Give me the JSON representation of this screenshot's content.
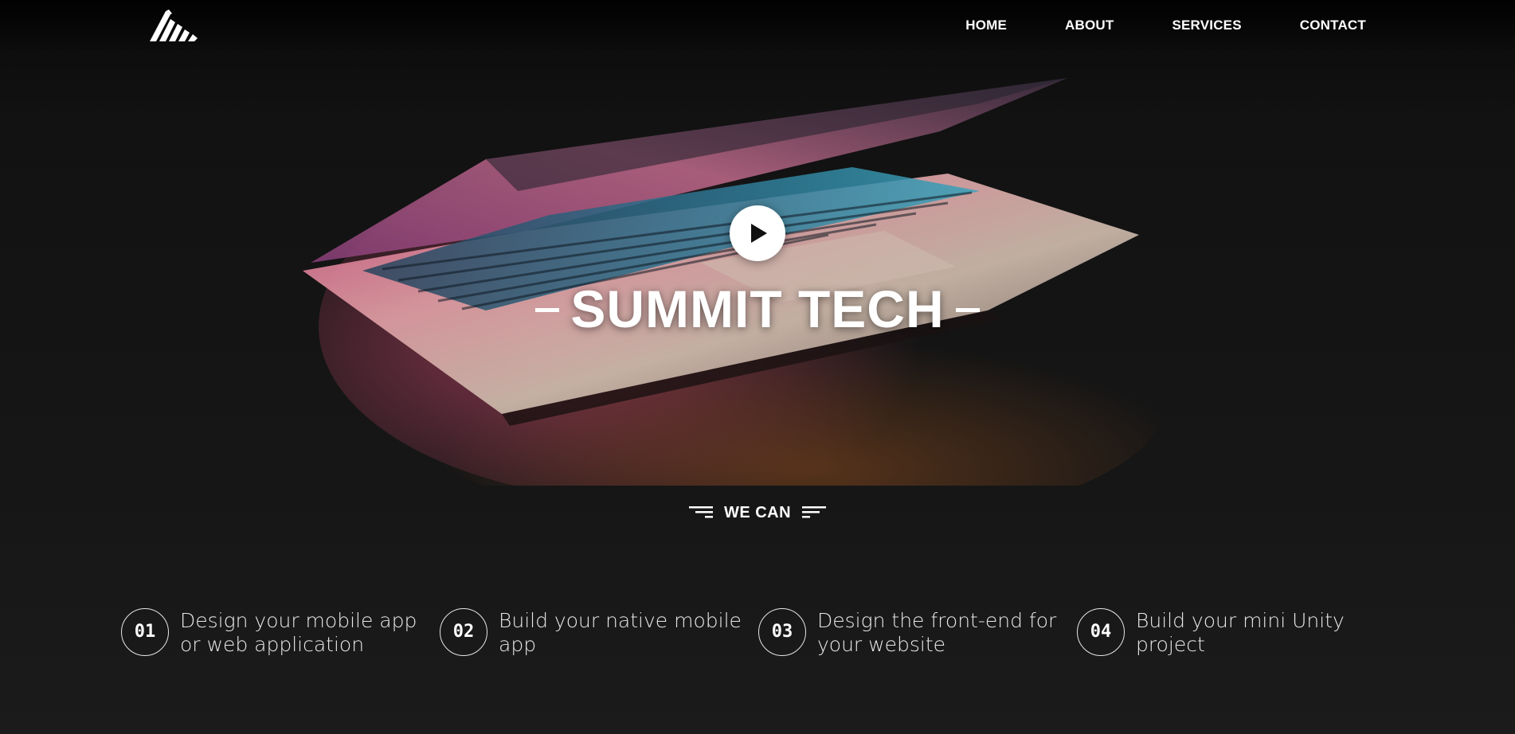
{
  "header": {
    "logo_icon": "mountain-stripes-icon",
    "nav": [
      {
        "label": "HOME"
      },
      {
        "label": "ABOUT"
      },
      {
        "label": "SERVICES"
      },
      {
        "label": "CONTACT"
      }
    ]
  },
  "hero": {
    "play_icon": "play-icon",
    "title": "SUMMIT TECH",
    "subtitle": "WE CAN"
  },
  "features": [
    {
      "number": "01",
      "text": "Design your mobile app or web application"
    },
    {
      "number": "02",
      "text": "Build your native mobile app"
    },
    {
      "number": "03",
      "text": "Design the front-end for your website"
    },
    {
      "number": "04",
      "text": "Build your mini Unity project"
    }
  ],
  "colors": {
    "background": "#1b1b1b",
    "text": "#ffffff",
    "accent_pink": "#c2406e",
    "accent_teal": "#3fb3c9",
    "accent_orange": "#8a4a1e"
  }
}
